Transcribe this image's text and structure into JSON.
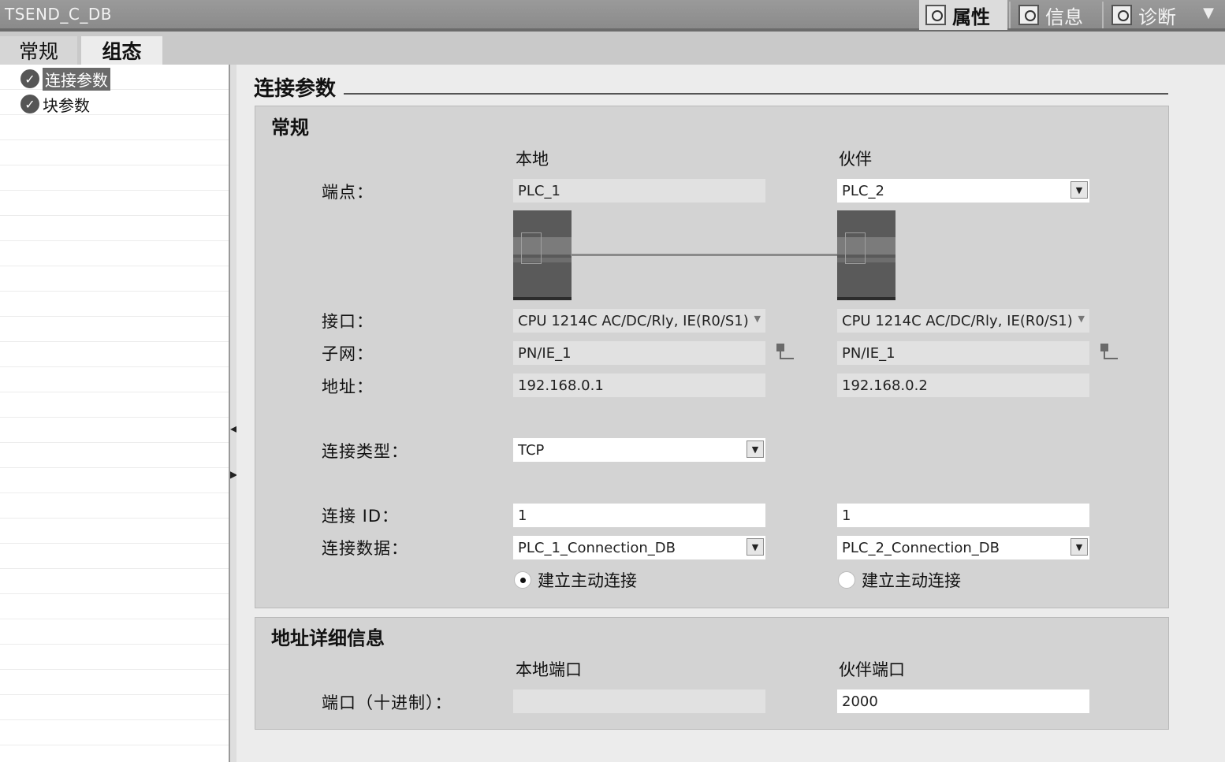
{
  "window": {
    "title": "TSEND_C_DB",
    "tabs": [
      {
        "label": "属性",
        "icon": "properties-icon",
        "active": true
      },
      {
        "label": "信息",
        "icon": "info-icon",
        "active": false
      },
      {
        "label": "诊断",
        "icon": "diagnostics-icon",
        "active": false
      }
    ],
    "menu_icon": "chevron-down-icon"
  },
  "left_tabs": [
    {
      "label": "常规",
      "active": false
    },
    {
      "label": "组态",
      "active": true
    }
  ],
  "nav": {
    "items": [
      {
        "label": "连接参数",
        "selected": true,
        "icon": "check-circle-icon"
      },
      {
        "label": "块参数",
        "selected": false,
        "icon": "check-circle-icon"
      }
    ]
  },
  "main": {
    "heading": "连接参数",
    "general": {
      "title": "常规",
      "col_local": "本地",
      "col_partner": "伙伴",
      "labels": {
        "endpoint": "端点：",
        "interface": "接口：",
        "subnet": "子网：",
        "address": "地址：",
        "conn_type": "连接类型：",
        "conn_id": "连接 ID：",
        "conn_data": "连接数据："
      },
      "local": {
        "endpoint": "PLC_1",
        "interface": "CPU 1214C AC/DC/Rly, IE(R0/S1)",
        "subnet": "PN/IE_1",
        "address": "192.168.0.1",
        "conn_type": "TCP",
        "conn_id": "1",
        "conn_data": "PLC_1_Connection_DB",
        "active_conn_label": "建立主动连接",
        "active_conn": true
      },
      "partner": {
        "endpoint": "PLC_2",
        "interface": "CPU 1214C AC/DC/Rly, IE(R0/S1)",
        "subnet": "PN/IE_1",
        "address": "192.168.0.2",
        "conn_id": "1",
        "conn_data": "PLC_2_Connection_DB",
        "active_conn_label": "建立主动连接",
        "active_conn": false
      }
    },
    "address_details": {
      "title": "地址详细信息",
      "col_local": "本地端口",
      "col_partner": "伙伴端口",
      "port_label": "端口（十进制）：",
      "local_port": "",
      "partner_port": "2000"
    }
  }
}
